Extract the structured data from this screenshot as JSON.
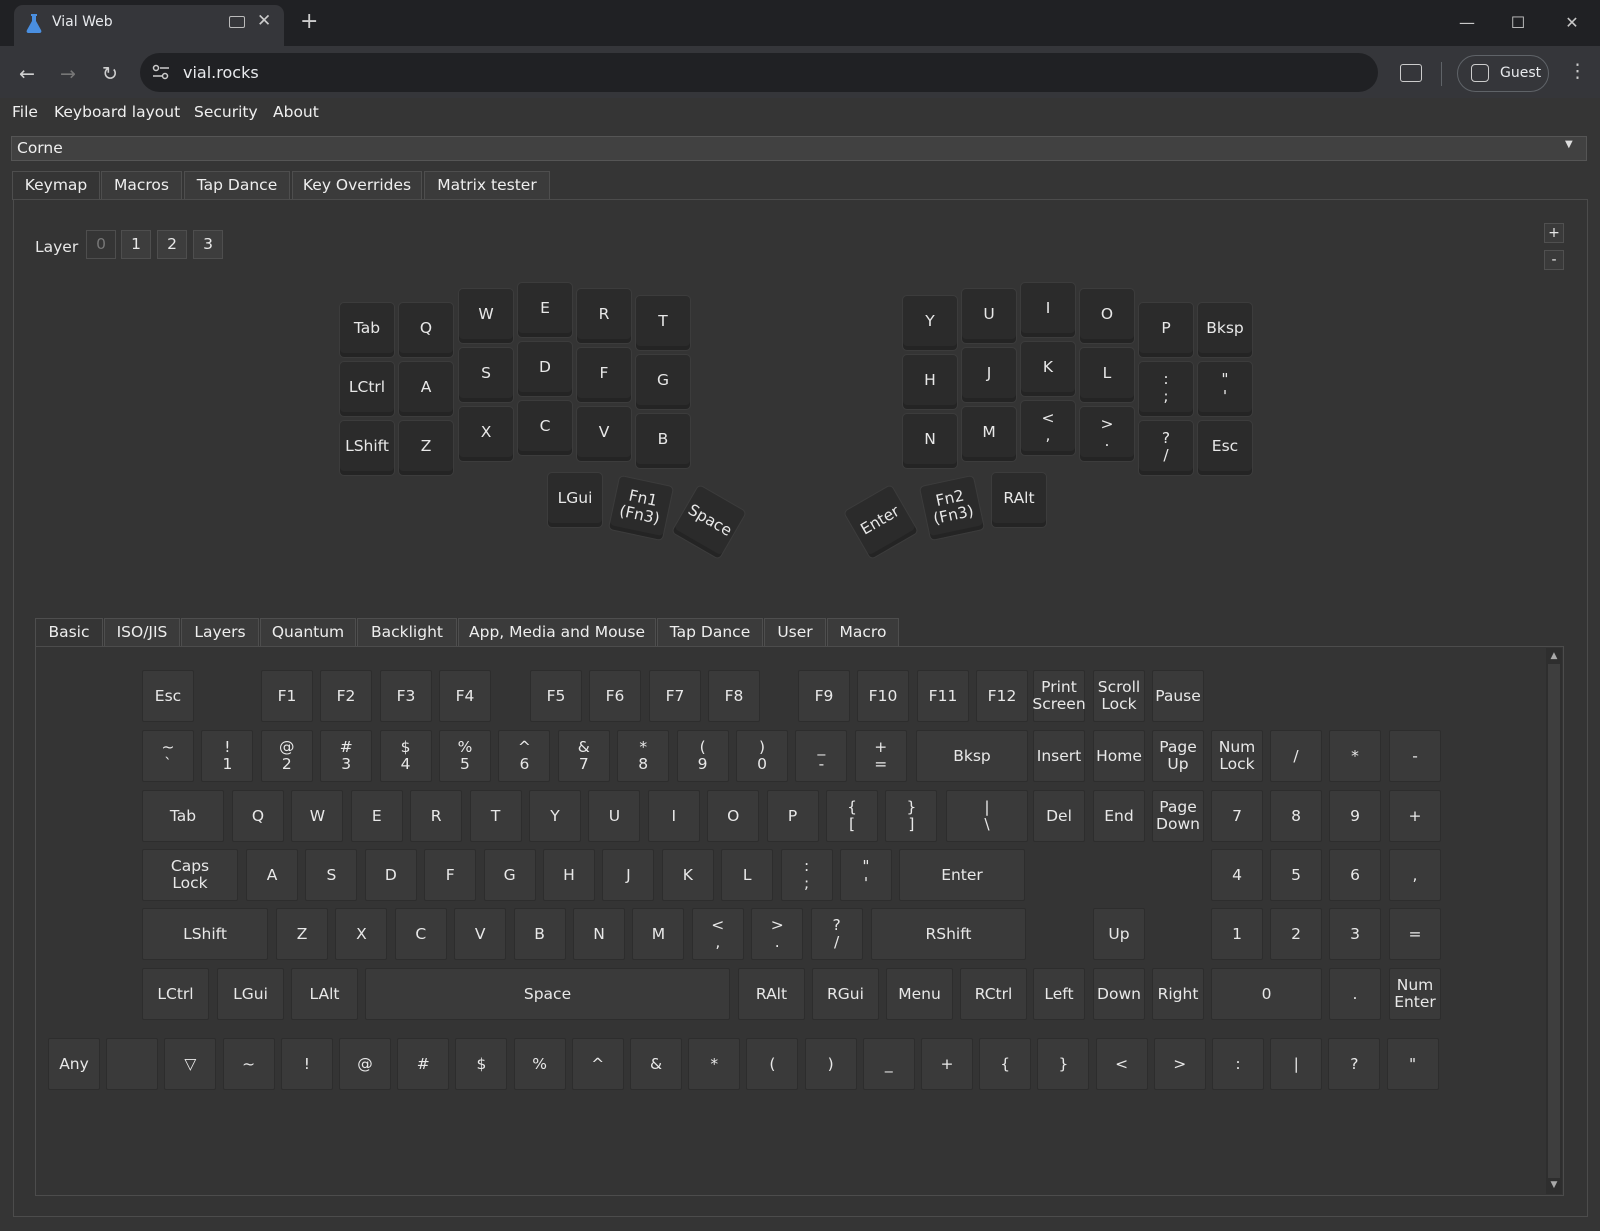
{
  "browser": {
    "tab_title": "Vial Web",
    "url": "vial.rocks",
    "profile_label": "Guest"
  },
  "menu": [
    "File",
    "Keyboard layout",
    "Security",
    "About"
  ],
  "keyboard_name": "Corne",
  "main_tabs": [
    "Keymap",
    "Macros",
    "Tap Dance",
    "Key Overrides",
    "Matrix tester"
  ],
  "layer": {
    "label": "Layer",
    "buttons": [
      "0",
      "1",
      "2",
      "3"
    ],
    "add_label": "+",
    "remove_label": "-"
  },
  "keymap": {
    "left": [
      [
        "Tab",
        "Q",
        "W",
        "E",
        "R",
        "T"
      ],
      [
        "LCtrl",
        "A",
        "S",
        "D",
        "F",
        "G"
      ],
      [
        "LShift",
        "Z",
        "X",
        "C",
        "V",
        "B"
      ]
    ],
    "right": [
      [
        "Y",
        "U",
        "I",
        "O",
        "P",
        "Bksp"
      ],
      [
        "H",
        "J",
        "K",
        "L",
        ":\n;",
        "\"\n'"
      ],
      [
        "N",
        "M",
        "<\n,",
        ">\n.",
        "?\n/",
        "Esc"
      ]
    ],
    "left_thumbs": [
      "LGui",
      "Fn1\n(Fn3)",
      "Space"
    ],
    "right_thumbs": [
      "Enter",
      "Fn2\n(Fn3)",
      "RAlt"
    ]
  },
  "keycode_tabs": [
    "Basic",
    "ISO/JIS",
    "Layers",
    "Quantum",
    "Backlight",
    "App, Media and Mouse",
    "Tap Dance",
    "User",
    "Macro"
  ],
  "keycodes": {
    "row1": [
      "Esc",
      "F1",
      "F2",
      "F3",
      "F4",
      "F5",
      "F6",
      "F7",
      "F8",
      "F9",
      "F10",
      "F11",
      "F12",
      "Print\nScreen",
      "Scroll\nLock",
      "Pause"
    ],
    "row2": [
      "~\n`",
      "!\n1",
      "@\n2",
      "#\n3",
      "$\n4",
      "%\n5",
      "^\n6",
      "&\n7",
      "*\n8",
      "(\n9",
      ")\n0",
      "_\n-",
      "+\n=",
      "Bksp",
      "Insert",
      "Home",
      "Page\nUp",
      "Num\nLock",
      "/",
      "*",
      "-"
    ],
    "row3": [
      "Tab",
      "Q",
      "W",
      "E",
      "R",
      "T",
      "Y",
      "U",
      "I",
      "O",
      "P",
      "{\n[",
      "}\n]",
      "|\n\\",
      "Del",
      "End",
      "Page\nDown",
      "7",
      "8",
      "9",
      "+"
    ],
    "row4": [
      "Caps\nLock",
      "A",
      "S",
      "D",
      "F",
      "G",
      "H",
      "J",
      "K",
      "L",
      ":\n;",
      "\"\n'",
      "Enter",
      "4",
      "5",
      "6",
      ","
    ],
    "row5": [
      "LShift",
      "Z",
      "X",
      "C",
      "V",
      "B",
      "N",
      "M",
      "<\n,",
      ">\n.",
      "?\n/",
      "RShift",
      "Up",
      "1",
      "2",
      "3",
      "="
    ],
    "row6": [
      "LCtrl",
      "LGui",
      "LAlt",
      "Space",
      "RAlt",
      "RGui",
      "Menu",
      "RCtrl",
      "Left",
      "Down",
      "Right",
      "0",
      ".",
      "Num\nEnter"
    ],
    "row7": [
      "Any",
      "",
      "▽",
      "~",
      "!",
      "@",
      "#",
      "$",
      "%",
      "^",
      "&",
      "*",
      "(",
      ")",
      "_",
      "+",
      "{",
      "}",
      "<",
      ">",
      ":",
      "|",
      "?",
      "\""
    ]
  }
}
